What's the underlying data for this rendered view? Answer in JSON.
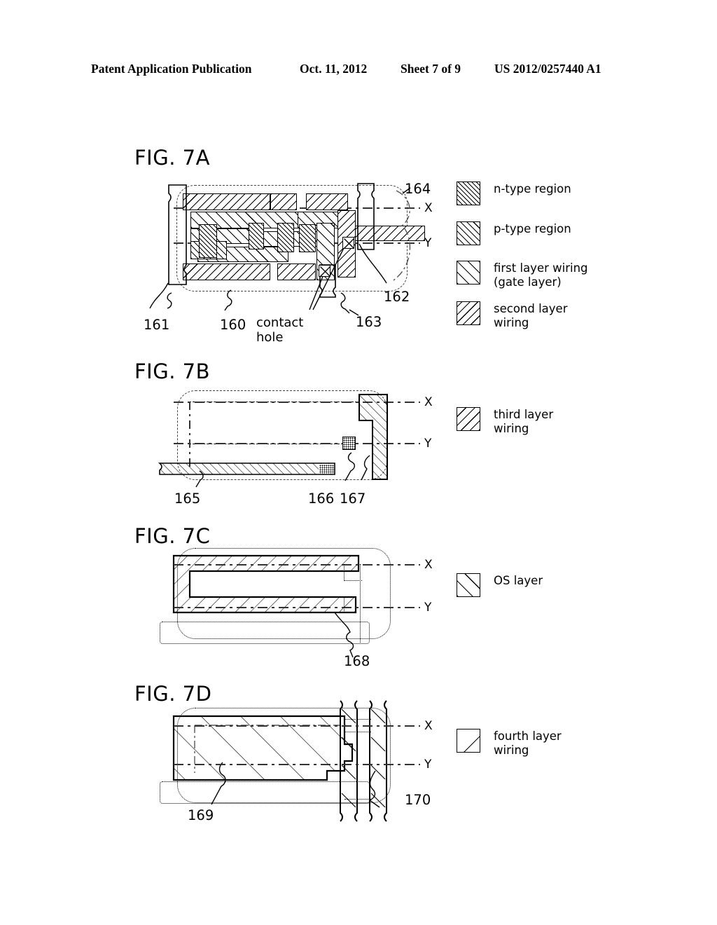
{
  "header": {
    "publication": "Patent Application Publication",
    "date": "Oct. 11, 2012",
    "sheet": "Sheet 7 of 9",
    "docnum": "US 2012/0257440 A1"
  },
  "figures": [
    {
      "id": "7a",
      "label": "FIG. 7A",
      "axis_labels": [
        "X",
        "Y"
      ],
      "reference_numbers": [
        "161",
        "160",
        "163",
        "162",
        "164"
      ],
      "annotations": [
        "contact hole"
      ],
      "legend": [
        {
          "name": "n-type region",
          "swatch": "n-type-swatch"
        },
        {
          "name": "p-type region",
          "swatch": "p-type-swatch"
        },
        {
          "name": "first layer wiring\n(gate layer)",
          "swatch": "first-layer-wiring-swatch"
        },
        {
          "name": "second layer\nwiring",
          "swatch": "second-layer-wiring-swatch"
        }
      ]
    },
    {
      "id": "7b",
      "label": "FIG. 7B",
      "axis_labels": [
        "X",
        "Y"
      ],
      "reference_numbers": [
        "165",
        "166",
        "167"
      ],
      "annotations": [],
      "legend": [
        {
          "name": "third layer\nwiring",
          "swatch": "third-layer-wiring-swatch"
        }
      ]
    },
    {
      "id": "7c",
      "label": "FIG. 7C",
      "axis_labels": [
        "X",
        "Y"
      ],
      "reference_numbers": [
        "168"
      ],
      "annotations": [],
      "legend": [
        {
          "name": "OS layer",
          "swatch": "os-layer-swatch"
        }
      ]
    },
    {
      "id": "7d",
      "label": "FIG. 7D",
      "axis_labels": [
        "X",
        "Y"
      ],
      "reference_numbers": [
        "169",
        "170"
      ],
      "annotations": [],
      "legend": [
        {
          "name": "fourth layer\nwiring",
          "swatch": "fourth-layer-wiring-swatch"
        }
      ]
    }
  ],
  "colors": {
    "ink": "#000000",
    "paper": "#ffffff",
    "centerline": "#555555"
  }
}
